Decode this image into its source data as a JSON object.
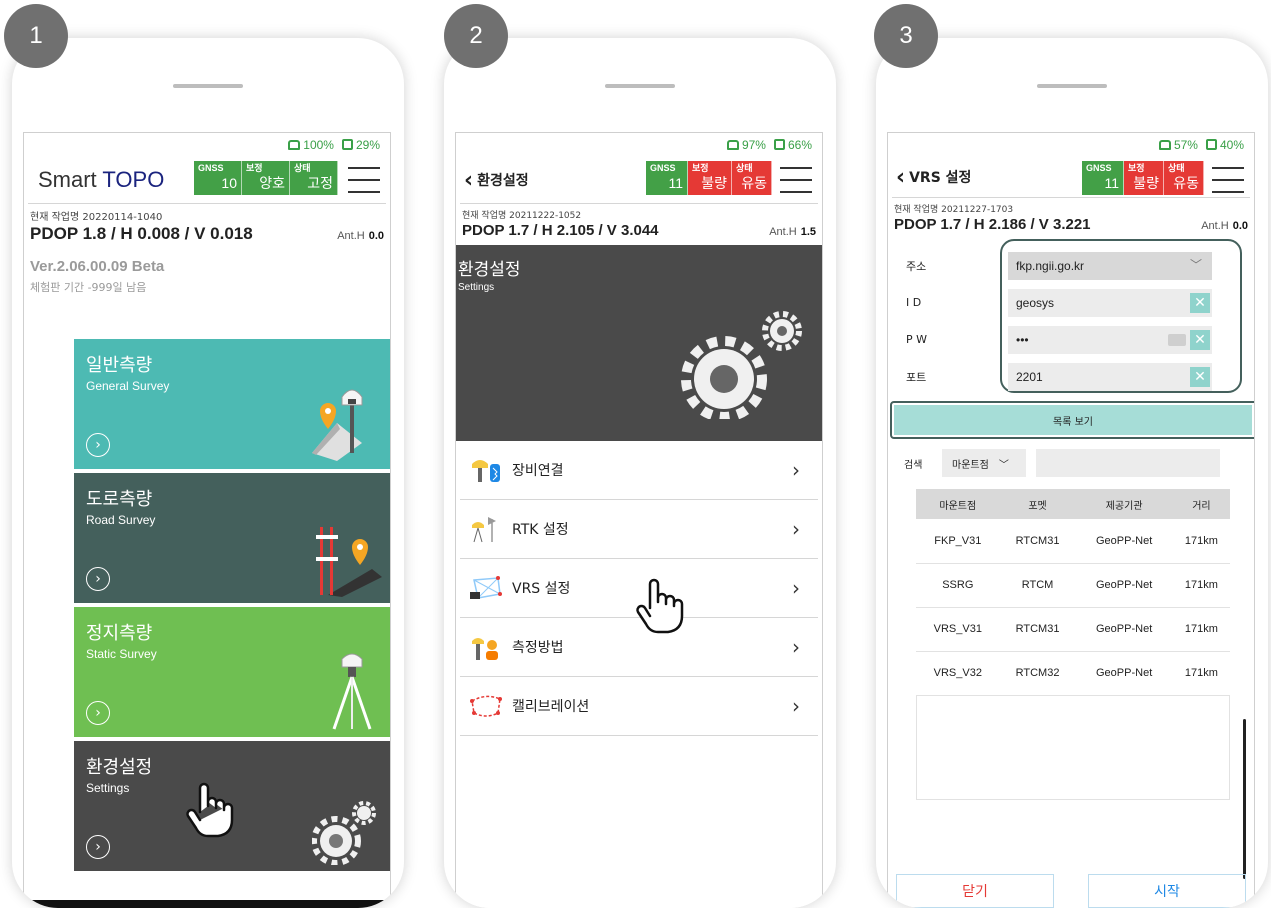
{
  "steps": [
    "1",
    "2",
    "3"
  ],
  "screen1": {
    "status": {
      "battery_pct": "100%",
      "phone_pct": "29%"
    },
    "app_title_prefix": "Smart ",
    "app_title_brand": "TOPO",
    "gnss": [
      {
        "label": "GNSS",
        "value": "10"
      },
      {
        "label": "보정",
        "value": "양호"
      },
      {
        "label": "상태",
        "value": "고정"
      }
    ],
    "job_label": "현재 작업명",
    "job_name": "20220114-1040",
    "pdop": "PDOP 1.8 / H 0.008 / V 0.018",
    "ant_label": "Ant.H",
    "ant_value": "0.0",
    "version": "Ver.2.06.00.09  Beta",
    "trial": "체험판 기간 -999일 남음",
    "tiles": [
      {
        "ko": "일반측량",
        "en": "General Survey",
        "color": "#4dbab3"
      },
      {
        "ko": "도로측량",
        "en": "Road Survey",
        "color": "#44605c"
      },
      {
        "ko": "정지측량",
        "en": "Static Survey",
        "color": "#6fbf52"
      },
      {
        "ko": "환경설정",
        "en": "Settings",
        "color": "#4a4a4a"
      }
    ],
    "go_glyph": "›"
  },
  "screen2": {
    "status": {
      "battery_pct": "97%",
      "phone_pct": "66%"
    },
    "back_label": "환경설정",
    "gnss": [
      {
        "label": "GNSS",
        "value": "11"
      },
      {
        "label": "보정",
        "value": "불량"
      },
      {
        "label": "상태",
        "value": "유동"
      }
    ],
    "job_label": "현재 작업명",
    "job_name": "20211222-1052",
    "pdop": "PDOP 1.7 / H 2.105 / V 3.044",
    "ant_label": "Ant.H",
    "ant_value": "1.5",
    "banner_ko": "환경설정",
    "banner_en": "Settings",
    "menu": [
      "장비연결",
      "RTK 설정",
      "VRS 설정",
      "측정방법",
      "캘리브레이션"
    ],
    "chevron": "›"
  },
  "screen3": {
    "status": {
      "battery_pct": "57%",
      "phone_pct": "40%"
    },
    "back_label": "VRS 설정",
    "gnss": [
      {
        "label": "GNSS",
        "value": "11"
      },
      {
        "label": "보정",
        "value": "불량"
      },
      {
        "label": "상태",
        "value": "유동"
      }
    ],
    "job_label": "현재 작업명",
    "job_name": "20211227-1703",
    "pdop": "PDOP 1.7 / H 2.186 / V 3.221",
    "ant_label": "Ant.H",
    "ant_value": "0.0",
    "fields": {
      "address_label": "주소",
      "address_value": "fkp.ngii.go.kr",
      "id_label": "I D",
      "id_value": "geosys",
      "pw_label": "P W",
      "pw_value": "•••",
      "port_label": "포트",
      "port_value": "2201"
    },
    "list_button": "목록 보기",
    "search_label": "검색",
    "search_select": "마운트점",
    "table_headers": [
      "마운트점",
      "포멧",
      "제공기관",
      "거리"
    ],
    "table_rows": [
      [
        "FKP_V31",
        "RTCM31",
        "GeoPP-Net",
        "171km"
      ],
      [
        "SSRG",
        "RTCM",
        "GeoPP-Net",
        "171km"
      ],
      [
        "VRS_V31",
        "RTCM31",
        "GeoPP-Net",
        "171km"
      ],
      [
        "VRS_V32",
        "RTCM32",
        "GeoPP-Net",
        "171km"
      ]
    ],
    "close_button": "닫기",
    "start_button": "시작"
  }
}
